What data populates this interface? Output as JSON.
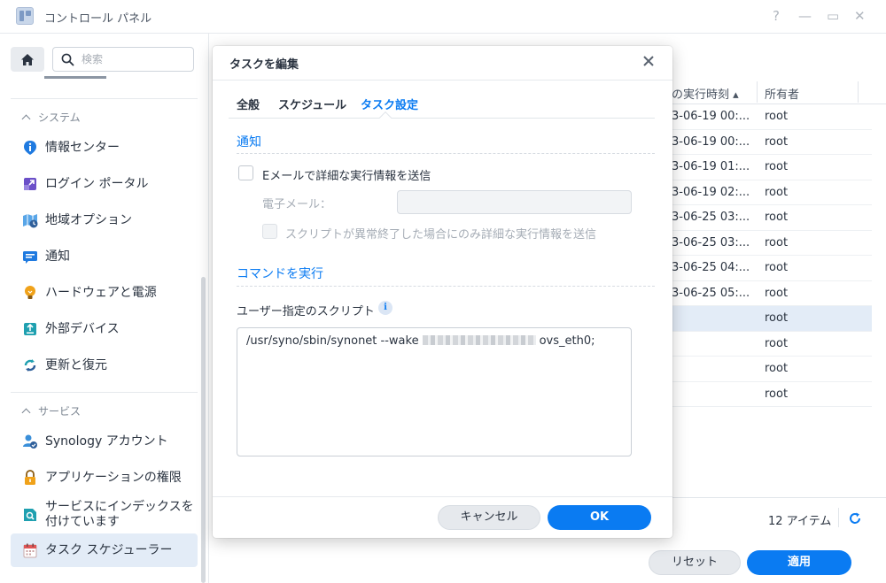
{
  "window": {
    "title": "コントロール パネル",
    "controls": [
      "?",
      "—",
      "▭",
      "✕"
    ]
  },
  "sidebar": {
    "search_placeholder": "検索",
    "sections": [
      {
        "title": "システム"
      },
      {
        "title": "サービス"
      }
    ],
    "items": [
      {
        "label": "情報センター",
        "icon": "info-icon",
        "color": "#1f7ae0"
      },
      {
        "label": "ログイン ポータル",
        "icon": "login-portal-icon",
        "color": "#6b4fc8"
      },
      {
        "label": "地域オプション",
        "icon": "region-icon",
        "color": "#3a8fd9"
      },
      {
        "label": "通知",
        "icon": "notification-icon",
        "color": "#1f7ae0"
      },
      {
        "label": "ハードウェアと電源",
        "icon": "lightbulb-icon",
        "color": "#f0a21a"
      },
      {
        "label": "外部デバイス",
        "icon": "external-device-icon",
        "color": "#1fa0b0"
      },
      {
        "label": "更新と復元",
        "icon": "update-restore-icon",
        "color": "#1fa0b0"
      },
      {
        "label": "Synology アカウント",
        "icon": "account-icon",
        "color": "#3a8fd9"
      },
      {
        "label": "アプリケーションの権限",
        "icon": "lock-icon",
        "color": "#f0a21a"
      },
      {
        "label": "サービスにインデックスを\n付けています",
        "icon": "index-icon",
        "color": "#1fa0b0"
      },
      {
        "label": "タスク スケジューラー",
        "icon": "calendar-icon",
        "color": "#e05656",
        "active": true
      }
    ]
  },
  "grid": {
    "columns": [
      "の実行時刻 ▴",
      "所有者"
    ],
    "rows": [
      {
        "time": "3-06-19 00:...",
        "owner": "root"
      },
      {
        "time": "3-06-19 00:...",
        "owner": "root"
      },
      {
        "time": "3-06-19 01:...",
        "owner": "root"
      },
      {
        "time": "3-06-19 02:...",
        "owner": "root"
      },
      {
        "time": "3-06-25 03:...",
        "owner": "root"
      },
      {
        "time": "3-06-25 03:...",
        "owner": "root"
      },
      {
        "time": "3-06-25 04:...",
        "owner": "root"
      },
      {
        "time": "3-06-25 05:...",
        "owner": "root"
      },
      {
        "time": "",
        "owner": "root",
        "selected": true
      },
      {
        "time": "",
        "owner": "root"
      },
      {
        "time": "",
        "owner": "root"
      },
      {
        "time": "",
        "owner": "root"
      }
    ],
    "count_label": "12 アイテム"
  },
  "footer": {
    "reset_label": "リセット",
    "apply_label": "適用"
  },
  "modal": {
    "title": "タスクを編集",
    "tabs": [
      "全般",
      "スケジュール",
      "タスク設定"
    ],
    "active_tab": "タスク設定",
    "notify": {
      "heading": "通知",
      "email_checkbox_label": "Eメールで詳細な実行情報を送信",
      "email_field_label": "電子メール：",
      "email_value": "",
      "abnormal_checkbox_label": "スクリプトが異常終了した場合にのみ詳細な実行情報を送信"
    },
    "command": {
      "heading": "コマンドを実行",
      "script_label": "ユーザー指定のスクリプト",
      "script_prefix": "/usr/syno/sbin/synonet --wake",
      "script_suffix": "ovs_eth0;"
    },
    "cancel_label": "キャンセル",
    "ok_label": "OK"
  },
  "colors": {
    "accent": "#0a7bf2",
    "selected_row": "#e3ecf7"
  }
}
